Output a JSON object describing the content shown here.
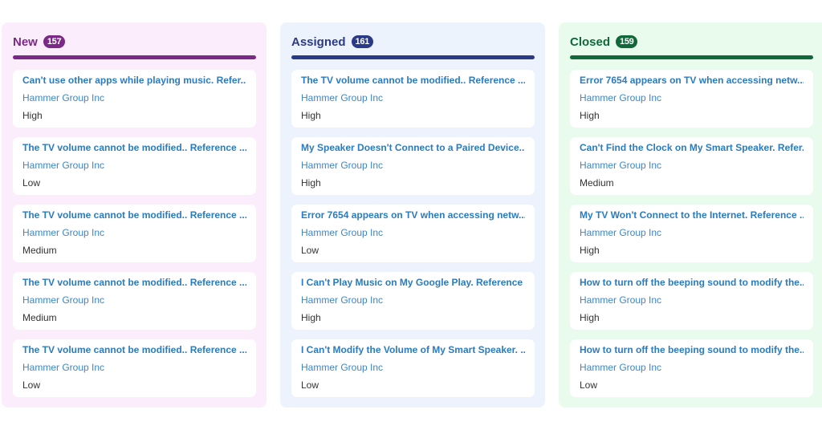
{
  "board": {
    "columns": [
      {
        "title": "New",
        "count": "157",
        "color": "#7a2a86",
        "cards": [
          {
            "title": "Can't use other apps while playing music. Refer...",
            "company": "Hammer Group Inc",
            "priority": "High"
          },
          {
            "title": "The TV volume cannot be modified.. Reference ...",
            "company": "Hammer Group Inc",
            "priority": "Low"
          },
          {
            "title": "The TV volume cannot be modified.. Reference ...",
            "company": "Hammer Group Inc",
            "priority": "Medium"
          },
          {
            "title": "The TV volume cannot be modified.. Reference ...",
            "company": "Hammer Group Inc",
            "priority": "Medium"
          },
          {
            "title": "The TV volume cannot be modified.. Reference ...",
            "company": "Hammer Group Inc",
            "priority": "Low"
          }
        ]
      },
      {
        "title": "Assigned",
        "count": "161",
        "color": "#2b3a86",
        "cards": [
          {
            "title": "The TV volume cannot be modified.. Reference ...",
            "company": "Hammer Group Inc",
            "priority": "High"
          },
          {
            "title": "My Speaker Doesn't Connect to a Paired Device....",
            "company": "Hammer Group Inc",
            "priority": "High"
          },
          {
            "title": "Error 7654 appears on TV when accessing netw...",
            "company": "Hammer Group Inc",
            "priority": "Low"
          },
          {
            "title": "I Can't Play Music on My Google Play. Reference ...",
            "company": "Hammer Group Inc",
            "priority": "High"
          },
          {
            "title": "I Can't Modify the Volume of My Smart Speaker. ...",
            "company": "Hammer Group Inc",
            "priority": "Low"
          }
        ]
      },
      {
        "title": "Closed",
        "count": "159",
        "color": "#11683a",
        "cards": [
          {
            "title": "Error 7654 appears on TV when accessing netw...",
            "company": "Hammer Group Inc",
            "priority": "High"
          },
          {
            "title": "Can't Find the Clock on My Smart Speaker. Refer...",
            "company": "Hammer Group Inc",
            "priority": "Medium"
          },
          {
            "title": "My TV Won't Connect to the Internet. Reference ...",
            "company": "Hammer Group Inc",
            "priority": "High"
          },
          {
            "title": "How to turn off the beeping sound to modify the...",
            "company": "Hammer Group Inc",
            "priority": "High"
          },
          {
            "title": "How to turn off the beeping sound to modify the...",
            "company": "Hammer Group Inc",
            "priority": "Low"
          }
        ]
      }
    ]
  }
}
